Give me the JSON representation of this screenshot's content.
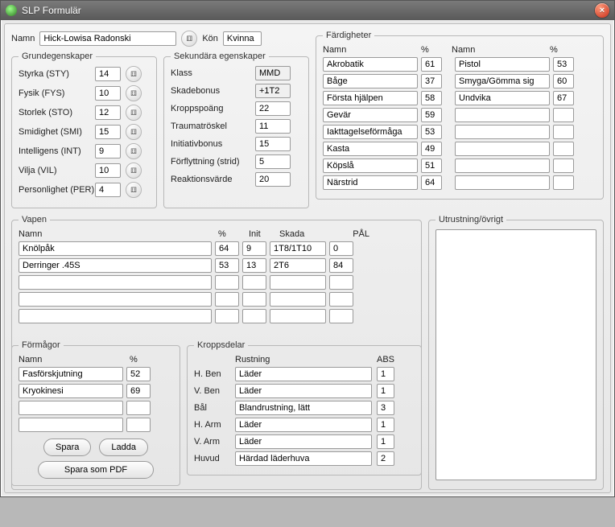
{
  "window": {
    "title": "SLP Formulär"
  },
  "labels": {
    "name": "Namn",
    "gender": "Kön",
    "grund": "Grundegenskaper",
    "sek": "Sekundära egenskaper",
    "fard": "Färdigheter",
    "pct": "%",
    "vapen": "Vapen",
    "init": "Init",
    "skada": "Skada",
    "pal": "PÅL",
    "utr": "Utrustning/övrigt",
    "form": "Förmågor",
    "kd": "Kroppsdelar",
    "rust": "Rustning",
    "abs": "ABS",
    "save": "Spara",
    "load": "Ladda",
    "pdf": "Spara som PDF"
  },
  "character": {
    "name": "Hick-Lowisa Radonski",
    "gender": "Kvinna"
  },
  "grund": [
    {
      "label": "Styrka (STY)",
      "val": "14"
    },
    {
      "label": "Fysik (FYS)",
      "val": "10"
    },
    {
      "label": "Storlek (STO)",
      "val": "12"
    },
    {
      "label": "Smidighet (SMI)",
      "val": "15"
    },
    {
      "label": "Intelligens (INT)",
      "val": "9"
    },
    {
      "label": "Vilja (VIL)",
      "val": "10"
    },
    {
      "label": "Personlighet (PER)",
      "val": "4"
    }
  ],
  "sek": [
    {
      "label": "Klass",
      "val": "MMD",
      "ro": true
    },
    {
      "label": "Skadebonus",
      "val": "+1T2",
      "ro": true
    },
    {
      "label": "Kroppspoäng",
      "val": "22"
    },
    {
      "label": "Traumatröskel",
      "val": "11"
    },
    {
      "label": "Initiativbonus",
      "val": "15"
    },
    {
      "label": "Förflyttning (strid)",
      "val": "5"
    },
    {
      "label": "Reaktionsvärde",
      "val": "20"
    }
  ],
  "fard": {
    "left": [
      {
        "name": "Akrobatik",
        "pct": "61"
      },
      {
        "name": "Båge",
        "pct": "37"
      },
      {
        "name": "Första hjälpen",
        "pct": "58"
      },
      {
        "name": "Gevär",
        "pct": "59"
      },
      {
        "name": "Iakttagelseförmåga",
        "pct": "53"
      },
      {
        "name": "Kasta",
        "pct": "49"
      },
      {
        "name": "Köpslå",
        "pct": "51"
      },
      {
        "name": "Närstrid",
        "pct": "64"
      }
    ],
    "right": [
      {
        "name": "Pistol",
        "pct": "53"
      },
      {
        "name": "Smyga/Gömma sig",
        "pct": "60"
      },
      {
        "name": "Undvika",
        "pct": "67"
      },
      {
        "name": "",
        "pct": ""
      },
      {
        "name": "",
        "pct": ""
      },
      {
        "name": "",
        "pct": ""
      },
      {
        "name": "",
        "pct": ""
      },
      {
        "name": "",
        "pct": ""
      }
    ]
  },
  "vapen": [
    {
      "name": "Knölpåk",
      "pct": "64",
      "init": "9",
      "skada": "1T8/1T10",
      "pal": "0"
    },
    {
      "name": "Derringer .45S",
      "pct": "53",
      "init": "13",
      "skada": "2T6",
      "pal": "84"
    },
    {
      "name": "",
      "pct": "",
      "init": "",
      "skada": "",
      "pal": ""
    },
    {
      "name": "",
      "pct": "",
      "init": "",
      "skada": "",
      "pal": ""
    },
    {
      "name": "",
      "pct": "",
      "init": "",
      "skada": "",
      "pal": ""
    }
  ],
  "utr": "",
  "form": [
    {
      "name": "Fasförskjutning",
      "pct": "52"
    },
    {
      "name": "Kryokinesi",
      "pct": "69"
    },
    {
      "name": "",
      "pct": ""
    },
    {
      "name": "",
      "pct": ""
    }
  ],
  "kd": [
    {
      "part": "H. Ben",
      "rust": "Läder",
      "abs": "1"
    },
    {
      "part": "V. Ben",
      "rust": "Läder",
      "abs": "1"
    },
    {
      "part": "Bål",
      "rust": "Blandrustning, lätt",
      "abs": "3"
    },
    {
      "part": "H. Arm",
      "rust": "Läder",
      "abs": "1"
    },
    {
      "part": "V. Arm",
      "rust": "Läder",
      "abs": "1"
    },
    {
      "part": "Huvud",
      "rust": "Härdad läderhuva",
      "abs": "2"
    }
  ]
}
